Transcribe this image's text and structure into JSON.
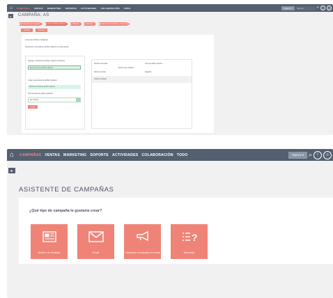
{
  "nav": {
    "items": [
      "CAMPAÑAS",
      "VENTAS",
      "MARKETING",
      "SOPORTE",
      "ACTIVIDADES",
      "COLABORACIÓN",
      "TODO"
    ],
    "create_label": "Nuevo ▾",
    "search_placeholder": "Buscar..."
  },
  "top": {
    "page_title": "CAMPAÑA: AS",
    "steps": [
      "Encabezado de Campaña",
      "Lista de Público Objetivo",
      "Marcado",
      "Marketing",
      "Enviar Correo Electrónico / Resumen"
    ],
    "buttons": [
      "Guardar",
      "Cancelar"
    ],
    "card_title": "Lista de Público Objetivo",
    "card_desc": "Seleccione una lista de público objetivo a continuación",
    "left_label1": "Agregar una lista de público objetivo existente",
    "left_field1": "Buscar lista de público objetivo",
    "left_label2": "Crear nueva lista de público objetivo",
    "left_field2": "Nombre de lista de público objetivo",
    "left_label3": "Tipo de lista de público objetivo",
    "left_select": "Por defecto",
    "left_button": "Crear",
    "right_col1": "Nombre de la lista",
    "right_col2": "Tipo de público objetivo",
    "right_sub": "Número de entradas",
    "right_row1": "Nombre de lista",
    "right_row2": "Seguidor",
    "right_footer": "Ningún resultado"
  },
  "bottom": {
    "page_title": "ASISTENTE DE CAMPAÑAS",
    "question": "¿Qué tipo de campaña le gustaría crear?",
    "tiles": [
      {
        "label": "Boletín de Noticias",
        "icon": "newsletter-icon"
      },
      {
        "label": "Email",
        "icon": "envelope-icon"
      },
      {
        "label": "Campaña no basada en email",
        "icon": "megaphone-icon"
      },
      {
        "label": "Encuesta",
        "icon": "survey-icon"
      }
    ]
  },
  "colors": {
    "nav": "#545f6f",
    "accent": "#f08377",
    "background": "#f1f1f2",
    "text": "#534d64"
  }
}
